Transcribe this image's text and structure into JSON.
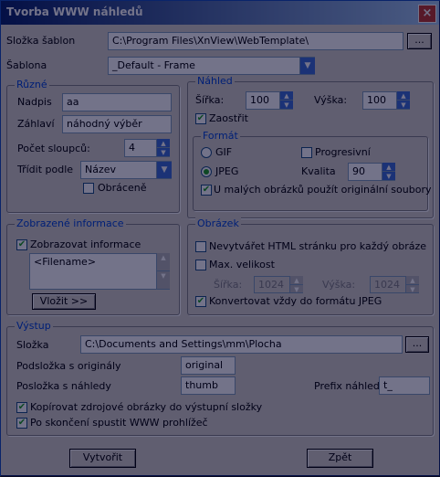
{
  "window": {
    "title": "Tvorba WWW náhledů",
    "close_label": "×"
  },
  "top": {
    "template_folder_label": "Složka šablon",
    "template_folder_value": "C:\\Program Files\\XnView\\WebTemplate\\",
    "browse_label": "...",
    "template_label": "Šablona",
    "template_value": "_Default - Frame"
  },
  "misc": {
    "title": "Různé",
    "caption_label": "Nadpis",
    "caption_value": "aa",
    "header_label": "Záhlaví",
    "header_value": "náhodný výběr",
    "columns_label": "Počet sloupců:",
    "columns_value": "4",
    "sort_label": "Třídit podle",
    "sort_value": "Název",
    "reverse_label": "Obráceně"
  },
  "preview": {
    "title": "Náhled",
    "width_label": "Šířka:",
    "width_value": "100",
    "height_label": "Výška:",
    "height_value": "100",
    "sharpen_label": "Zaostřit"
  },
  "format": {
    "title": "Formát",
    "gif_label": "GIF",
    "progressive_label": "Progresivní",
    "jpeg_label": "JPEG",
    "quality_label": "Kvalita",
    "quality_value": "90",
    "small_orig_label": "U malých obrázků použít originální soubory"
  },
  "info": {
    "title": "Zobrazené informace",
    "show_label": "Zobrazovat informace",
    "text_value": "<Filename>",
    "insert_label": "Vložit >>"
  },
  "image": {
    "title": "Obrázek",
    "no_html_label": "Nevytvářet HTML stránku pro každý obráze",
    "max_size_label": "Max. velikost",
    "width_label": "Šířka:",
    "width_value": "1024",
    "height_label": "Výška:",
    "height_value": "1024",
    "convert_label": "Konvertovat vždy do formátu JPEG"
  },
  "output": {
    "title": "Výstup",
    "folder_label": "Složka",
    "folder_value": "C:\\Documents and Settings\\mm\\Plocha",
    "browse_label": "...",
    "orig_sub_label": "Podsložka s originály",
    "orig_sub_value": "original",
    "thumb_sub_label": "Posložka s náhledy",
    "thumb_sub_value": "thumb",
    "prefix_label": "Prefix náhledů",
    "prefix_value": "t_",
    "copy_label": "Kopírovat zdrojové obrázky do výstupní složky",
    "launch_label": "Po skončení spustit WWW prohlížeč"
  },
  "buttons": {
    "create_label": "Vytvořit",
    "back_label": "Zpět"
  }
}
